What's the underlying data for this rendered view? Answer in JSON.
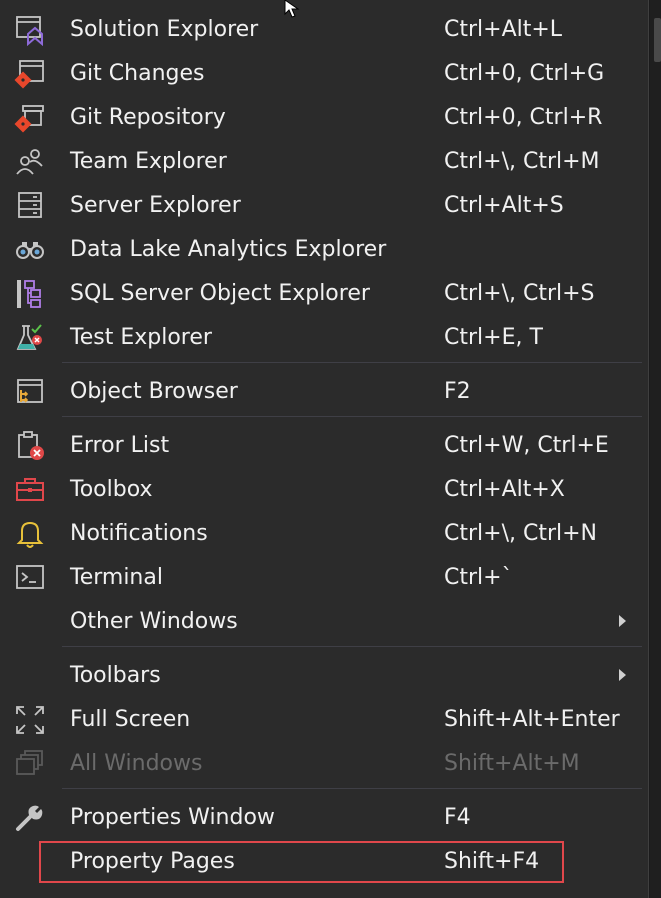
{
  "menu": {
    "items": [
      {
        "label": "Solution Explorer",
        "shortcut": "Ctrl+Alt+L",
        "icon": "solution-explorer-icon"
      },
      {
        "label": "Git Changes",
        "shortcut": "Ctrl+0, Ctrl+G",
        "icon": "git-changes-icon"
      },
      {
        "label": "Git Repository",
        "shortcut": "Ctrl+0, Ctrl+R",
        "icon": "git-repository-icon"
      },
      {
        "label": "Team Explorer",
        "shortcut": "Ctrl+\\, Ctrl+M",
        "icon": "team-explorer-icon"
      },
      {
        "label": "Server Explorer",
        "shortcut": "Ctrl+Alt+S",
        "icon": "server-explorer-icon"
      },
      {
        "label": "Data Lake Analytics Explorer",
        "shortcut": "",
        "icon": "binoculars-icon"
      },
      {
        "label": "SQL Server Object Explorer",
        "shortcut": "Ctrl+\\, Ctrl+S",
        "icon": "sql-object-explorer-icon"
      },
      {
        "label": "Test Explorer",
        "shortcut": "Ctrl+E, T",
        "icon": "test-explorer-icon"
      },
      {
        "label": "Object Browser",
        "shortcut": "F2",
        "icon": "object-browser-icon"
      },
      {
        "label": "Error List",
        "shortcut": "Ctrl+W, Ctrl+E",
        "icon": "error-list-icon"
      },
      {
        "label": "Toolbox",
        "shortcut": "Ctrl+Alt+X",
        "icon": "toolbox-icon"
      },
      {
        "label": "Notifications",
        "shortcut": "Ctrl+\\, Ctrl+N",
        "icon": "bell-icon"
      },
      {
        "label": "Terminal",
        "shortcut": "Ctrl+`",
        "icon": "terminal-icon"
      },
      {
        "label": "Other Windows",
        "shortcut": "",
        "icon": "",
        "submenu": true
      },
      {
        "label": "Toolbars",
        "shortcut": "",
        "icon": "",
        "submenu": true
      },
      {
        "label": "Full Screen",
        "shortcut": "Shift+Alt+Enter",
        "icon": "full-screen-icon"
      },
      {
        "label": "All Windows",
        "shortcut": "Shift+Alt+M",
        "icon": "all-windows-icon",
        "disabled": true
      },
      {
        "label": "Properties Window",
        "shortcut": "F4",
        "icon": "wrench-icon"
      },
      {
        "label": "Property Pages",
        "shortcut": "Shift+F4",
        "icon": "",
        "highlighted": true
      }
    ]
  },
  "colors": {
    "menu_background": "#2b2b2b",
    "text": "#f1f1f1",
    "disabled_text": "#6b6b6b",
    "highlight_border": "#e0474b",
    "accent_purple": "#8d6ad8",
    "git_orange": "#e8472b"
  }
}
